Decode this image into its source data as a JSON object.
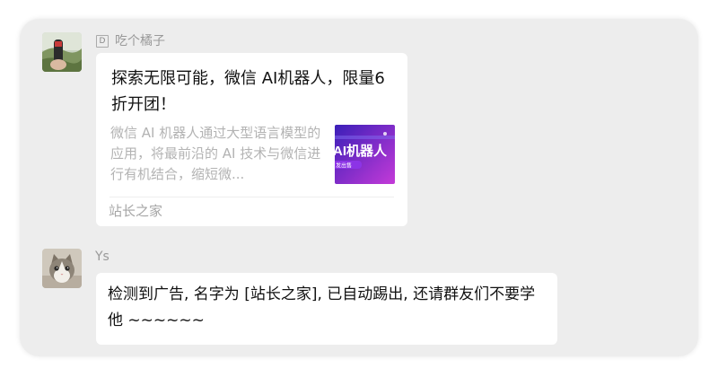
{
  "chat": {
    "messages": [
      {
        "sender": "吃个橘子",
        "sender_tag": "D",
        "type": "link-card",
        "card": {
          "title": "探索无限可能，微信 AI机器人，限量6折开团！",
          "description": "微信 AI 机器人通过大型语言模型的应用，将最前沿的 AI 技术与微信进行有机结合，缩短微...",
          "thumbnail_text": "AI机器人",
          "thumbnail_subtext": "发出售",
          "source": "站长之家"
        }
      },
      {
        "sender": "Ys",
        "type": "text",
        "text": "检测到广告, 名字为 [站长之家], 已自动踢出, 还请群友们不要学他 ~~~~~~"
      }
    ]
  },
  "colors": {
    "panel_background": "#ededed",
    "bubble_background": "#ffffff",
    "thumbnail_gradient_start": "#3a1fb8",
    "thumbnail_gradient_end": "#c43ad8"
  },
  "icons": {
    "avatar_1": "person-outdoors-avatar-icon",
    "avatar_2": "cat-avatar-icon"
  }
}
